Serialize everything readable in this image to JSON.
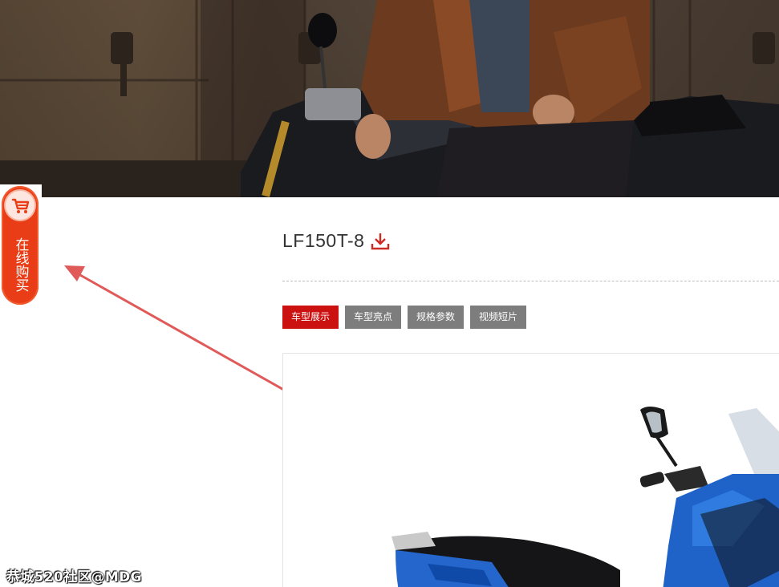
{
  "hero": {
    "image": "motorcycle-rider-banner-photo"
  },
  "float_buy": {
    "label": "在线购买",
    "icon": "shopping-cart-icon",
    "color": "#e83d16"
  },
  "product": {
    "model": "LF150T-8",
    "download_icon": "download-icon"
  },
  "tabs": [
    {
      "label": "车型展示",
      "active": true
    },
    {
      "label": "车型亮点",
      "active": false
    },
    {
      "label": "规格参数",
      "active": false
    },
    {
      "label": "视频短片",
      "active": false
    }
  ],
  "colors": {
    "accent_red": "#cc1111",
    "tab_gray": "#7d7d7d",
    "annotation_arrow": "#e05a5a"
  },
  "product_image": "blue-scooter-photo",
  "watermark": "恭城520社区@MDG"
}
